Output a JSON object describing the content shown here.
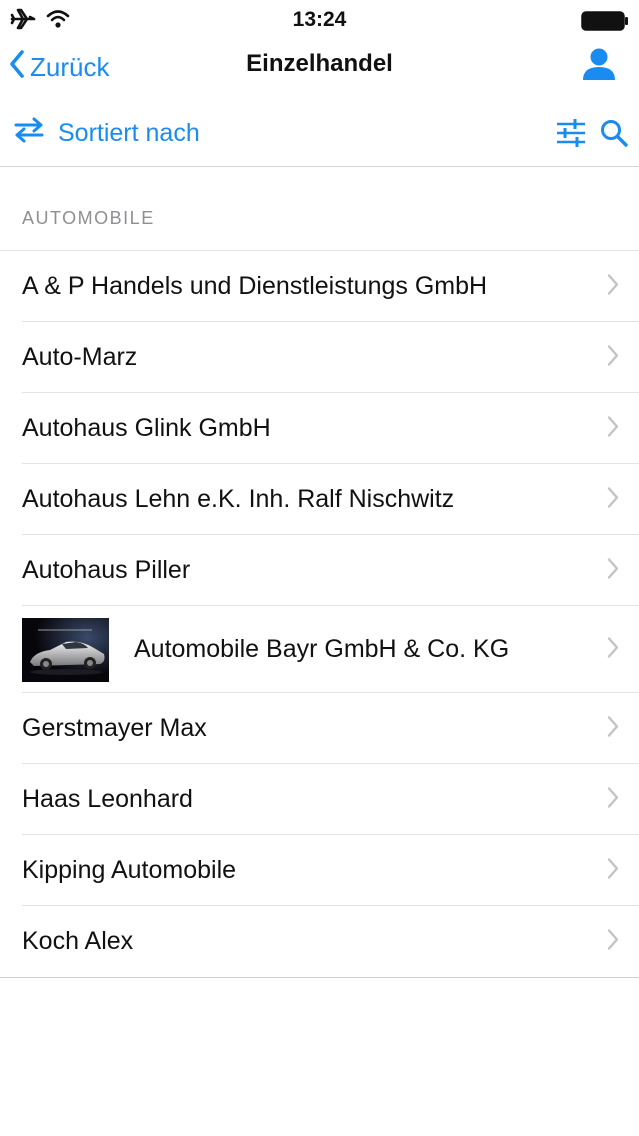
{
  "status_bar": {
    "time": "13:24",
    "icons": [
      "airplane-icon",
      "wifi-icon",
      "battery-icon"
    ]
  },
  "nav": {
    "back_label": "Zurück",
    "title": "Einzelhandel",
    "profile_icon": "person-icon"
  },
  "toolbar": {
    "sort_label": "Sortiert nach",
    "sort_icon": "swap-arrows-icon",
    "filter_icon": "sliders-icon",
    "search_icon": "search-icon"
  },
  "colors": {
    "accent": "#1a8cf0",
    "section_header": "#8e8e93",
    "separator": "#e3e3e5"
  },
  "section": {
    "title": "AUTOMOBILE"
  },
  "items": [
    {
      "label": "A & P Handels und Dienstleistungs GmbH"
    },
    {
      "label": "Auto-Marz"
    },
    {
      "label": "Autohaus Glink GmbH"
    },
    {
      "label": "Autohaus Lehn e.K. Inh. Ralf Nischwitz"
    },
    {
      "label": "Autohaus Piller"
    },
    {
      "label": "Automobile Bayr GmbH & Co. KG",
      "has_image": true,
      "image": "car-thumbnail"
    },
    {
      "label": "Gerstmayer Max"
    },
    {
      "label": "Haas Leonhard"
    },
    {
      "label": "Kipping Automobile"
    },
    {
      "label": "Koch Alex"
    }
  ]
}
